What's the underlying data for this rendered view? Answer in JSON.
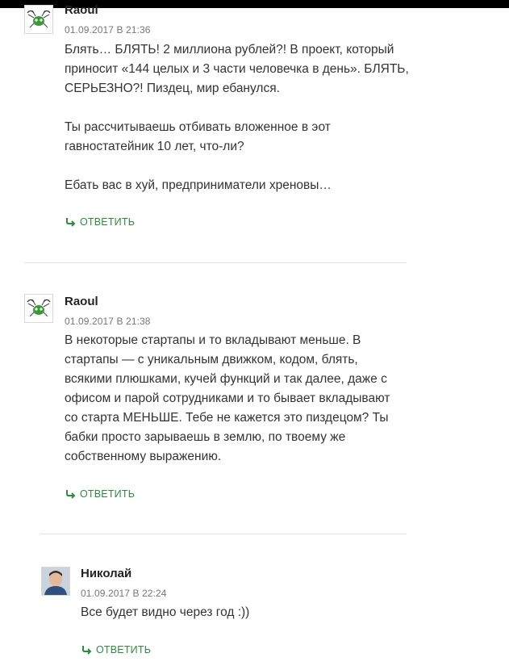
{
  "comments": [
    {
      "author": "Raoul",
      "date": "01.09.2017 В 21:36",
      "paragraphs": [
        [
          "Блять… БЛЯТЬ! 2 миллиона рублей?! В проект, который",
          "приносит «144 целых и 3 части человечка в день». БЛЯТЬ,",
          "СЕРЬЕЗНО?! Пиздец, мир ебанулся."
        ],
        [
          "Ты рассчитываешь отбивать вложенное в эот",
          "гавностатейник 10 лет, что-ли?"
        ],
        [
          "Ебать вас в хуй, предприниматели хреновы…"
        ]
      ],
      "reply_label": "ОТВЕТИТЬ"
    },
    {
      "author": "Raoul",
      "date": "01.09.2017 В 21:38",
      "paragraphs": [
        [
          "В некоторые стартапы и то вкладывают меньше. В",
          "стартапы — с уникальным движком, кодом, блять,",
          "всякими плюшками, кучей функций и так далее, даже с",
          "офисом и парой сотрудниками и то бывает вкладывают",
          "со старта МЕНЬШЕ. Тебе не кажется это пиздецом? Ты",
          "бабки просто зарываешь в землю, по твоему же",
          "собственному выражению."
        ]
      ],
      "reply_label": "ОТВЕТИТЬ"
    },
    {
      "author": "Николай",
      "date": "01.09.2017 В 22:24",
      "paragraphs": [
        [
          "Все будет видно через год :))"
        ]
      ],
      "reply_label": "ОТВЕТИТЬ"
    }
  ],
  "colors": {
    "accent": "#2e8b3d",
    "meta": "#767676",
    "text": "#333333"
  },
  "icons": {
    "reply": "reply-arrow-icon",
    "avatar_raoul": "green-bug-avatar",
    "avatar_nikolai": "user-photo-avatar"
  }
}
